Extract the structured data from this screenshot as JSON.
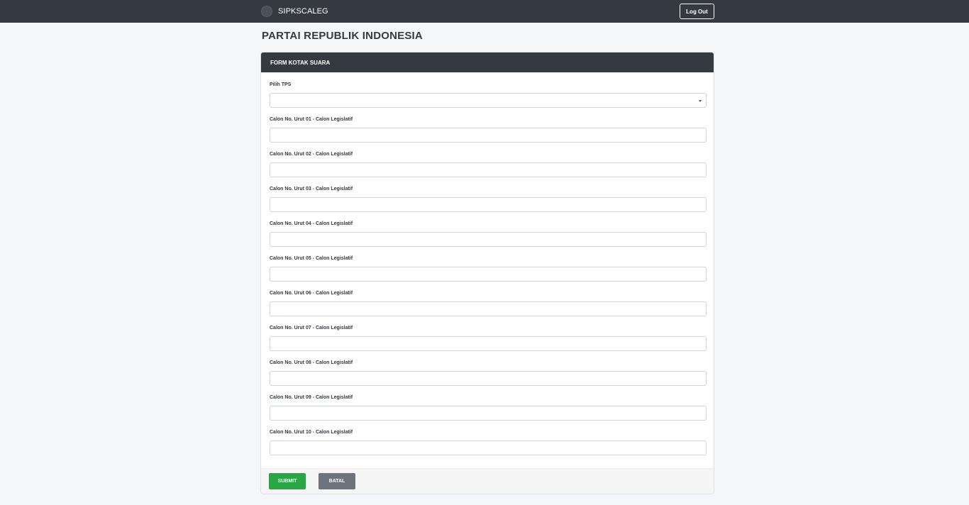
{
  "navbar": {
    "brand": "SIPKSCALEG",
    "logout_label": "Log Out"
  },
  "page": {
    "title": "PARTAI REPUBLIK INDONESIA"
  },
  "form": {
    "header": "FORM KOTAK SUARA",
    "tps_label": "Pilih TPS",
    "tps_selected": "",
    "fields": [
      {
        "label": "Calon No. Urut 01 - Calon Legislatif",
        "value": ""
      },
      {
        "label": "Calon No. Urut 02 - Calon Legislatif",
        "value": ""
      },
      {
        "label": "Calon No. Urut 03 - Calon Legislatif",
        "value": ""
      },
      {
        "label": "Calon No. Urut 04 - Calon Legislatif",
        "value": ""
      },
      {
        "label": "Calon No. Urut 05 - Calon Legislatif",
        "value": ""
      },
      {
        "label": "Calon No. Urut 06 - Calon Legislatif",
        "value": ""
      },
      {
        "label": "Calon No. Urut 07 - Calon Legislatif",
        "value": ""
      },
      {
        "label": "Calon No. Urut 08 - Calon Legislatif",
        "value": ""
      },
      {
        "label": "Calon No. Urut 09 - Calon Legislatif",
        "value": ""
      },
      {
        "label": "Calon No. Urut 10 - Calon Legislatif",
        "value": ""
      }
    ],
    "submit_label": "SUBMIT",
    "cancel_label": "BATAL"
  },
  "colors": {
    "navbar": "#343a40",
    "submit": "#28a745",
    "cancel": "#6c757d",
    "background": "#f4f6f9"
  }
}
